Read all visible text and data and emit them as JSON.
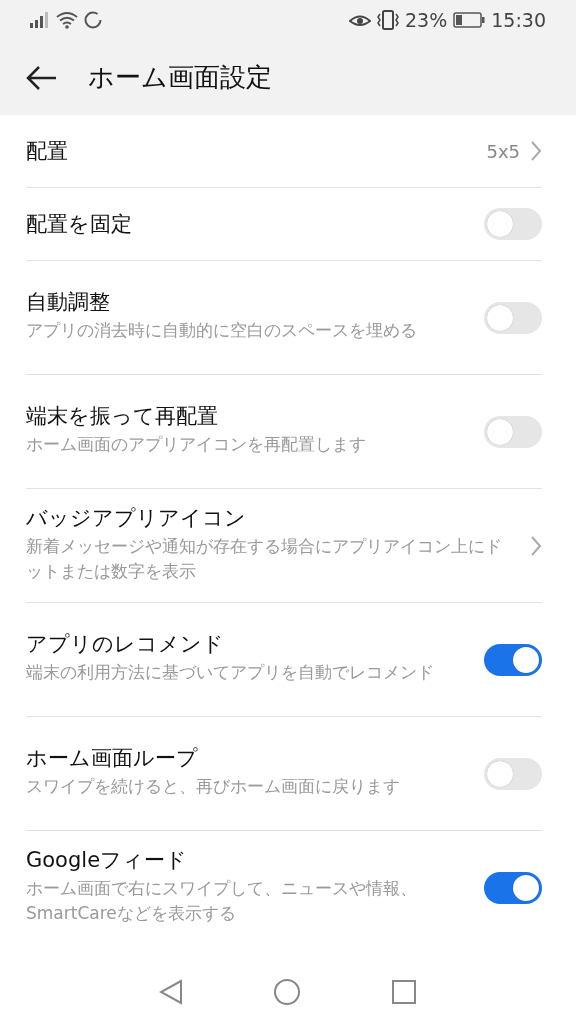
{
  "status_bar": {
    "battery_percent": "23%",
    "time": "15:30"
  },
  "header": {
    "title": "ホーム画面設定"
  },
  "settings": [
    {
      "kind": "value",
      "title": "配置",
      "value": "5x5"
    },
    {
      "kind": "toggle",
      "title": "配置を固定",
      "on": false
    },
    {
      "kind": "toggle",
      "title": "自動調整",
      "description": "アプリの消去時に自動的に空白のスペースを埋める",
      "on": false
    },
    {
      "kind": "toggle",
      "title": "端末を振って再配置",
      "description": "ホーム画面のアプリアイコンを再配置します",
      "on": false
    },
    {
      "kind": "link",
      "title": "バッジアプリアイコン",
      "description": "新着メッセージや通知が存在する場合にアプリアイコン上にドットまたは数字を表示"
    },
    {
      "kind": "toggle",
      "title": "アプリのレコメンド",
      "description": "端末の利用方法に基づいてアプリを自動でレコメンド",
      "on": true
    },
    {
      "kind": "toggle",
      "title": "ホーム画面ループ",
      "description": "スワイプを続けると、再びホーム画面に戻ります",
      "on": false
    },
    {
      "kind": "toggle",
      "title": "Googleフィード",
      "description": "ホーム画面で右にスワイプして、ニュースや情報、SmartCareなどを表示する",
      "on": true
    }
  ]
}
